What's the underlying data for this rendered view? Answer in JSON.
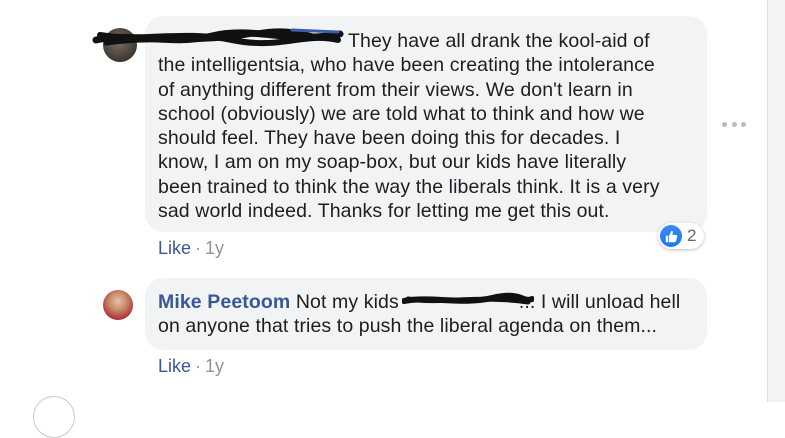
{
  "comments": [
    {
      "author": "",
      "text": "They have all drank the kool-aid of\nthe intelligentsia, who have been creating the intolerance\nof anything different from their views. We don't learn in\nschool (obviously) we are told what to think and how we\nshould feel. They have been doing this for decades. I\nknow, I am on my soap-box, but our kids have literally\nbeen trained to think the way the liberals think. It is a very\nsad world indeed. Thanks for letting me get this out.",
      "like_label": "Like",
      "separator": "·",
      "time": "1y",
      "reaction_count": "2",
      "reaction_icon": "thumbs-up-icon"
    },
    {
      "author": "Mike Peetoom",
      "text_before_redaction": "Not my kids",
      "text_after_redaction": "... I will unload hell\non anyone that tries to push the liberal agenda on them...",
      "like_label": "Like",
      "separator": "·",
      "time": "1y"
    }
  ],
  "icons": {
    "more_options": "more-horizontal-icon"
  },
  "colors": {
    "author_link": "#385898",
    "bubble_bg": "#f2f3f5",
    "meta_gray": "#8d949e",
    "like_blue": "#1877f2",
    "redaction_ink": "#111111"
  }
}
